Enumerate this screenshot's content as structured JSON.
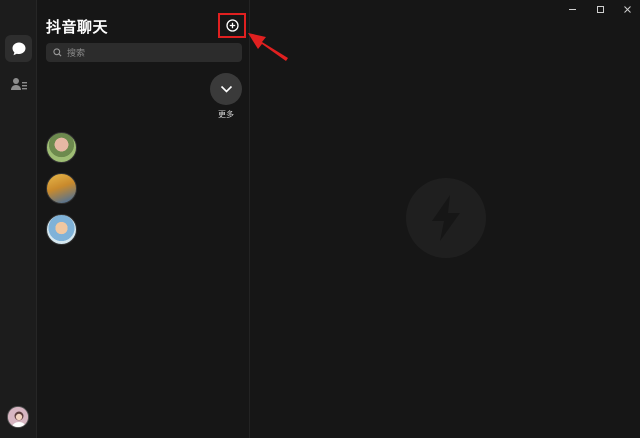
{
  "app": {
    "title": "抖音聊天"
  },
  "search": {
    "placeholder": "搜索"
  },
  "more": {
    "label": "更多"
  },
  "nav": {
    "items": [
      {
        "icon": "chat-bubble-icon",
        "active": true
      },
      {
        "icon": "contacts-icon",
        "active": false
      }
    ]
  },
  "contacts": [
    {
      "avatar": "avatar-girl-green-background"
    },
    {
      "avatar": "avatar-autumn-trees"
    },
    {
      "avatar": "avatar-child-blue-shirt"
    }
  ],
  "colors": {
    "background": "#161616",
    "rail": "#1c1c1c",
    "highlight": "#e02020",
    "search_bg": "#2c2c2c"
  },
  "window_controls": [
    "minimize-icon",
    "maximize-icon",
    "close-icon"
  ]
}
